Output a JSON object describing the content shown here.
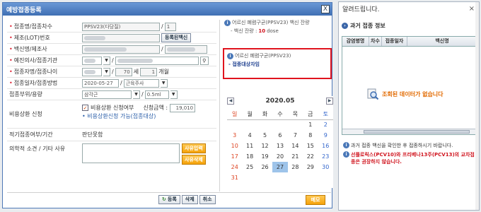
{
  "main_window": {
    "title": "예방접종등록",
    "close": "X"
  },
  "form": {
    "dose_label": "접종명/접종차수",
    "dose_value": "PPSV23(다당질)",
    "dose_num": "1",
    "lot_label": "제조(LOT)번호",
    "lot_button": "등록된백신",
    "vaccine_label": "백신명/제조사",
    "vaccine_value": "",
    "inst_label": "예진의사/접종기관",
    "age_label": "접종자명/접종나이",
    "age_years": "70",
    "age_unit_years": "세",
    "age_months": "1",
    "age_unit_months": "개월",
    "date_label": "접종일자/접종방법",
    "date_value": "2020-05-27",
    "method_value": "근육주사",
    "site_label": "접종부위/용량",
    "site_value": "삼각근",
    "volume_value": "0.5ml",
    "cost_label": "비용상환 신청",
    "cost_check": "비용상환 신청여부",
    "cost_amount_label": "신청금액 :",
    "cost_amount": "19,010",
    "cost_note": "• 비용상환신청 가능(접종대상)",
    "proper_label": "적기접종여부/기간",
    "proper_value": "판단못함",
    "opinion_label": "의학적 소견 / 기타 사유",
    "reason_button": "사유입력",
    "reason_delete": "사유삭제"
  },
  "info_panel": {
    "line1": "어르신 폐렴구균(PPSV23) 백신 잔량",
    "line1_sub": "- 백신 잔량 :",
    "line1_qty": "10",
    "line1_unit": "dose",
    "line2": "어르신 폐렴구균(PPSV23)",
    "line2_sub": "- 접종대상자임"
  },
  "calendar": {
    "month": "2020.05",
    "weekdays": [
      "일",
      "월",
      "화",
      "수",
      "목",
      "금",
      "토"
    ],
    "weeks": [
      [
        "",
        "",
        "",
        "",
        "",
        "1",
        "2"
      ],
      [
        "3",
        "4",
        "5",
        "6",
        "7",
        "8",
        "9"
      ],
      [
        "10",
        "11",
        "12",
        "13",
        "14",
        "15",
        "16"
      ],
      [
        "17",
        "18",
        "19",
        "20",
        "21",
        "22",
        "23"
      ],
      [
        "24",
        "25",
        "26",
        "27",
        "28",
        "29",
        "30"
      ],
      [
        "31",
        "",
        "",
        "",
        "",
        "",
        ""
      ]
    ],
    "selected_day": "27"
  },
  "footer": {
    "register": "등록",
    "delete": "삭제",
    "cancel": "취소",
    "memo": "메모"
  },
  "popup": {
    "title": "알려드립니다.",
    "close": "×",
    "subtitle": "과거 접종 정보",
    "columns": [
      "감염병명",
      "차수",
      "접종일자",
      "백신명"
    ],
    "no_data": "조회된 데이터가 없습니다",
    "note1": "과거 접종 백신을 확인한 후 접종하시기 바랍니다.",
    "note2": "선플로릭스(PCV10)와 프리베나13주(PCV13)의 교차접종은 권장하지 않습니다."
  }
}
